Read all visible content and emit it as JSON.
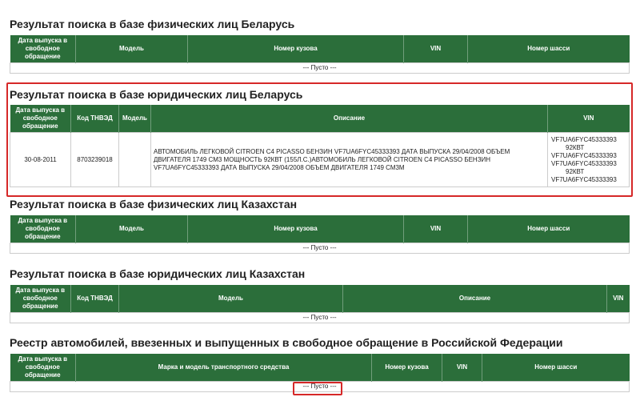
{
  "empty_text": "--- Пусто ---",
  "s1": {
    "title": "Результат поиска в базе физических лиц Беларусь",
    "cols": [
      "Дата выпуска в свободное обращение",
      "Модель",
      "Номер кузова",
      "VIN",
      "Номер шасси"
    ]
  },
  "s2": {
    "title": "Результат поиска в базе юридических лиц Беларусь",
    "cols": [
      "Дата выпуска в свободное обращение",
      "Код ТНВЭД",
      "Модель",
      "Описание",
      "VIN"
    ],
    "row": {
      "date": "30-08-2011",
      "code": "8703239018",
      "model": "",
      "description": "АВТОМОБИЛЬ ЛЕГКОВОЙ CITROEN C4 PICASSO БЕНЗИН VF7UA6FYC45333393 ДАТА ВЫПУСКА 29/04/2008 ОБЪЕМ ДВИГАТЕЛЯ 1749 СМ3 МОЩНОСТЬ 92КВТ (155Л.С.)АВТОМОБИЛЬ ЛЕГКОВОЙ CITROEN C4 PICASSO БЕНЗИН VF7UA6FYC45333393 ДАТА ВЫПУСКА 29/04/2008 ОБЪЕМ ДВИГАТЕЛЯ 1749 СМ3М",
      "vin_lines": [
        "VF7UA6FYC45333393",
        "92КВТ",
        "VF7UA6FYC45333393",
        "VF7UA6FYC45333393",
        "92КВТ",
        "VF7UA6FYC45333393"
      ]
    }
  },
  "s3": {
    "title": "Результат поиска в базе физических лиц Казахстан",
    "cols": [
      "Дата выпуска в свободное обращение",
      "Модель",
      "Номер кузова",
      "VIN",
      "Номер шасси"
    ]
  },
  "s4": {
    "title": "Результат поиска в базе юридических лиц Казахстан",
    "cols": [
      "Дата выпуска в свободное обращение",
      "Код ТНВЭД",
      "Модель",
      "Описание",
      "VIN"
    ]
  },
  "s5": {
    "title": "Реестр автомобилей, ввезенных и выпущенных в свободное обращение в Российской Федерации",
    "cols": [
      "Дата выпуска в свободное обращение",
      "Марка и модель транспортного средства",
      "Номер кузова",
      "VIN",
      "Номер шасси"
    ]
  },
  "colors": {
    "header_green": "#2b6e3a",
    "highlight_red": "#d62828"
  }
}
